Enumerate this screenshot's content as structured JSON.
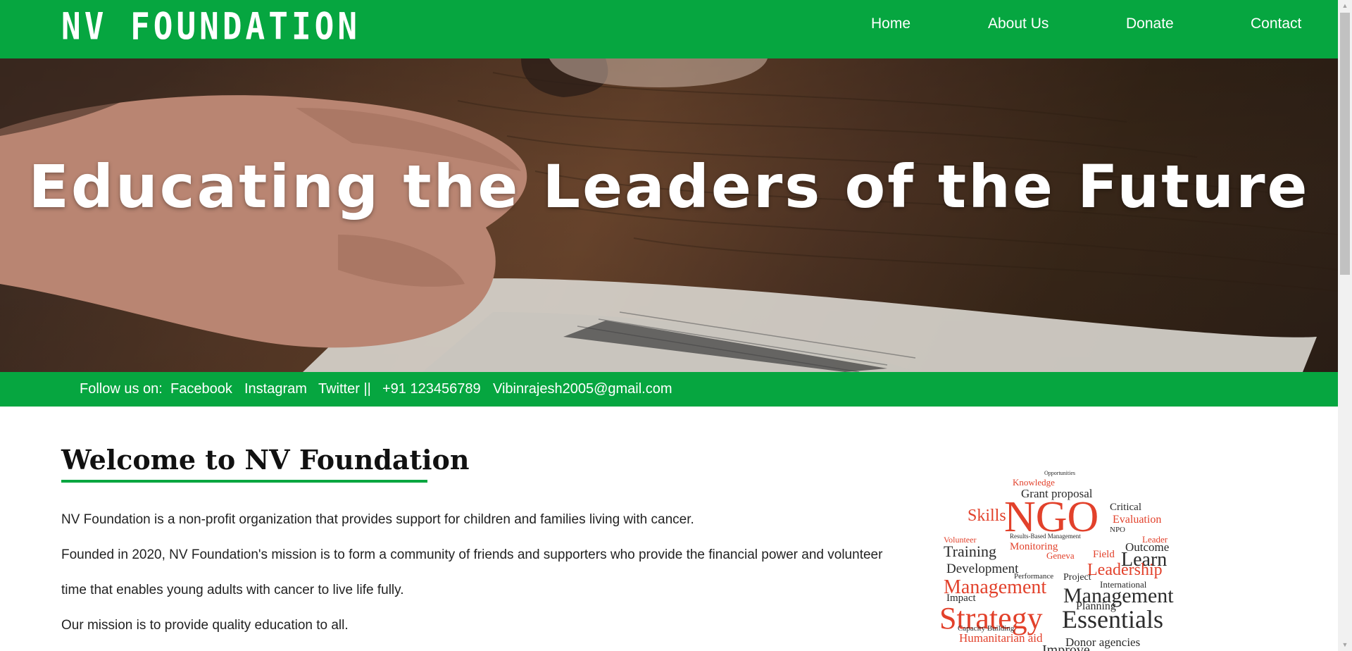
{
  "header": {
    "logo": "NV FOUNDATION",
    "nav": [
      "Home",
      "About Us",
      "Donate",
      "Contact"
    ]
  },
  "hero": {
    "title": "Educating the Leaders of the Future"
  },
  "follow_bar": {
    "label": "Follow us on:",
    "facebook": "Facebook",
    "instagram": "Instagram",
    "twitter": "Twitter ||",
    "phone": "+91 123456789",
    "email": "Vibinrajesh2005@gmail.com"
  },
  "main": {
    "heading": "Welcome to NV Foundation",
    "paragraphs": [
      "NV Foundation is a non-profit organization that provides support for children and families living with cancer.",
      "Founded in 2020, NV Foundation's mission is to form a community of friends and supporters who provide the financial power and volunteer",
      "time that enables young adults with cancer to live life fully.",
      "Our mission is to provide quality education to all."
    ]
  },
  "word_cloud": {
    "words": [
      "Opportunities",
      "Knowledge",
      "Grant proposal",
      "Skills",
      "NGO",
      "Evaluation",
      "Critical",
      "Leader",
      "Training",
      "Monitoring",
      "Outcome",
      "Learn",
      "Development",
      "Leadership",
      "Management",
      "International",
      "Project",
      "Management",
      "Strategy",
      "Impact",
      "Planning",
      "Essentials",
      "Humanitarian aid",
      "Donor agencies",
      "Capacity Building",
      "Field",
      "Performance",
      "Geneva",
      "NPO",
      "Volunteer",
      "Results-Based Management",
      "Improve"
    ]
  },
  "colors": {
    "brand_green": "#06a640",
    "text_dark": "#111111",
    "cloud_red": "#e2412b",
    "cloud_dark": "#2b2b2b"
  }
}
